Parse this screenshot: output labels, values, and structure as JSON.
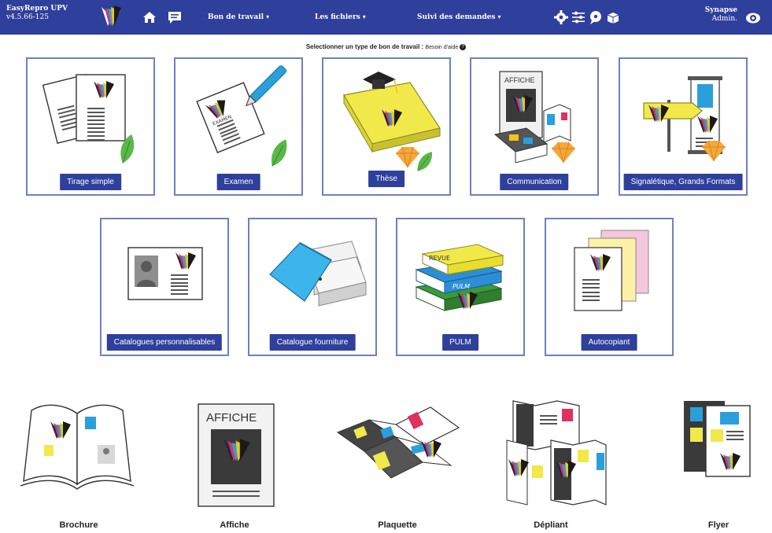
{
  "app": {
    "name": "EasyRepro UPV",
    "version": "v4.5.66-125"
  },
  "nav": {
    "home_icon": "home-icon",
    "message_icon": "chat-icon",
    "menus": [
      {
        "label": "Bon de travail"
      },
      {
        "label": "Les fichiers"
      },
      {
        "label": "Suivi des demandes"
      }
    ],
    "tools": [
      "gear-icon",
      "sliders-icon",
      "chat-bubble-icon",
      "box-icon"
    ]
  },
  "user": {
    "name": "Synapse",
    "role": "Admin."
  },
  "prompt": {
    "text": "Selectionner un type de bon de travail :",
    "help": "Besoin d'aide"
  },
  "cards_row1": [
    {
      "label": "Tirage simple"
    },
    {
      "label": "Examen"
    },
    {
      "label": "Thèse"
    },
    {
      "label": "Communication"
    },
    {
      "label": "Signalétique, Grands Formats"
    }
  ],
  "cards_row2": [
    {
      "label": "Catalogues personnalisables"
    },
    {
      "label": "Catalogue fourniture"
    },
    {
      "label": "PULM"
    },
    {
      "label": "Autocopiant"
    }
  ],
  "art_text": {
    "affiche": "AFFICHE",
    "examen": "EXAMEN",
    "revue": "REVUE",
    "pulm": "PULM"
  },
  "products": [
    {
      "label": "Brochure"
    },
    {
      "label": "Affiche"
    },
    {
      "label": "Plaquette"
    },
    {
      "label": "Dépliant"
    },
    {
      "label": "Flyer"
    }
  ],
  "colors": {
    "nav": "#2f3f9c",
    "card_border": "#6f7fc4",
    "button": "#2f3f9c"
  }
}
